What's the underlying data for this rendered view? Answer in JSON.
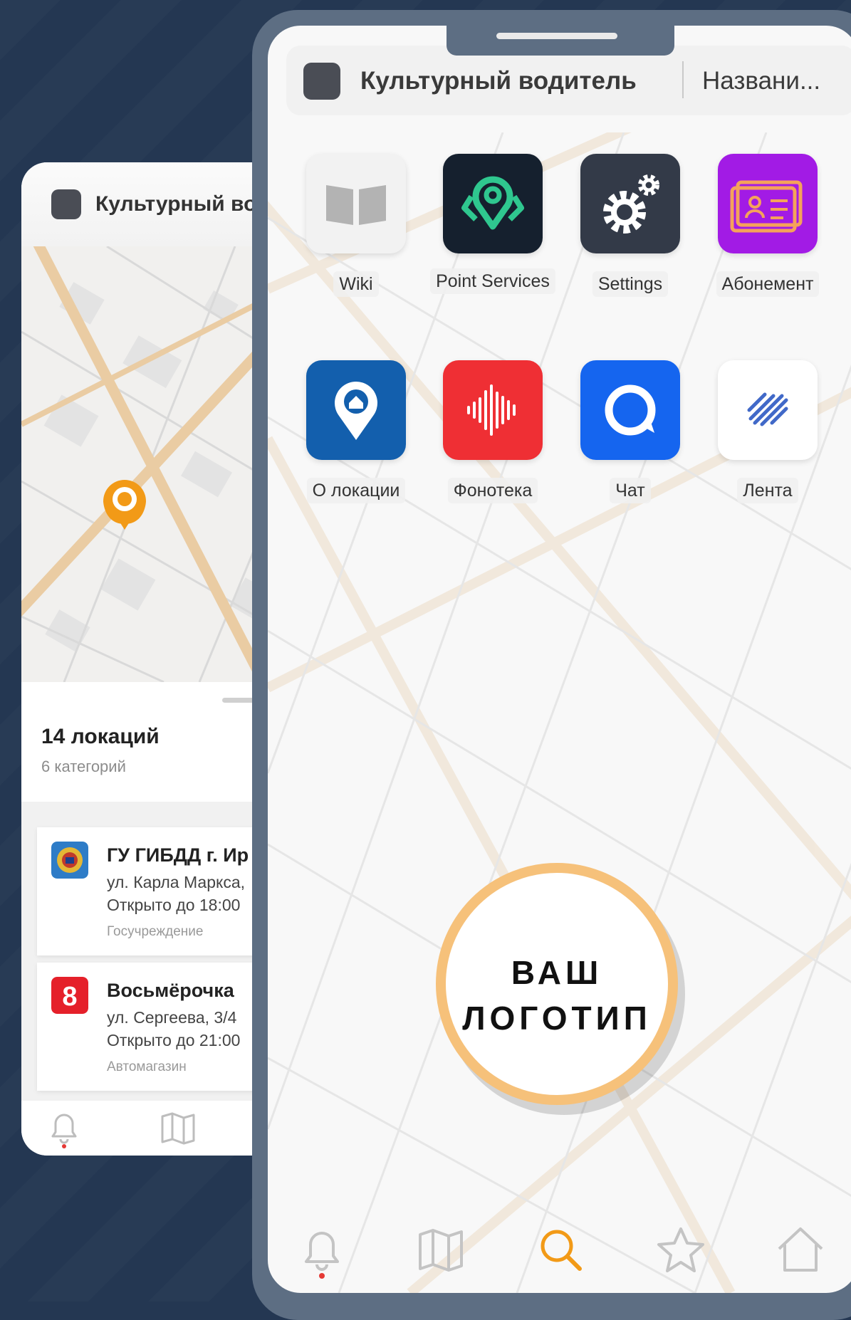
{
  "colors": {
    "background": "#243752",
    "phone_frame": "#5d6e83",
    "accent_orange": "#f29a17",
    "logo_ring": "#f6c17a"
  },
  "back_screen": {
    "header_title": "Культурный вод",
    "summary": {
      "title": "14 локаций",
      "subtitle": "6 категорий"
    },
    "locations": [
      {
        "name": "ГУ ГИБДД г. Ир",
        "address": "ул. Карла Маркса,",
        "hours": "Открыто до 18:00",
        "category": "Госучреждение",
        "icon": "police-emblem-icon"
      },
      {
        "name": "Восьмёрочка",
        "address": "ул. Сергеева, 3/4",
        "hours": "Открыто до 21:00",
        "category": "Автомагазин",
        "icon": "number-8-logo-icon"
      }
    ],
    "tabbar_icons": [
      "bell-icon",
      "map-icon",
      "search-icon"
    ]
  },
  "front_screen": {
    "header": {
      "title": "Культурный водитель",
      "subtitle": "Названи..."
    },
    "apps": [
      {
        "label": "Wiki",
        "icon": "book-icon",
        "color": "#f2f2f2"
      },
      {
        "label": "Point Services",
        "icon": "location-pin-icon",
        "color": "#15202e"
      },
      {
        "label": "Settings",
        "icon": "gear-icon",
        "color": "#333a48"
      },
      {
        "label": "Абонемент",
        "icon": "id-card-icon",
        "color": "#a21be5"
      },
      {
        "label": "О локации",
        "icon": "location-home-icon",
        "color": "#135fad"
      },
      {
        "label": "Фонотека",
        "icon": "sound-wave-icon",
        "color": "#ef2f34"
      },
      {
        "label": "Чат",
        "icon": "chat-icon",
        "color": "#1565ef"
      },
      {
        "label": "Лента",
        "icon": "feed-lines-icon",
        "color": "#ffffff"
      }
    ],
    "logo_placeholder": {
      "line1": "ВАШ",
      "line2": "ЛОГОТИП"
    },
    "tabbar": [
      {
        "icon": "bell-icon",
        "active": false,
        "has_notification": true
      },
      {
        "icon": "map-icon",
        "active": false
      },
      {
        "icon": "search-icon",
        "active": true
      },
      {
        "icon": "star-icon",
        "active": false
      },
      {
        "icon": "home-icon",
        "active": false
      }
    ]
  }
}
